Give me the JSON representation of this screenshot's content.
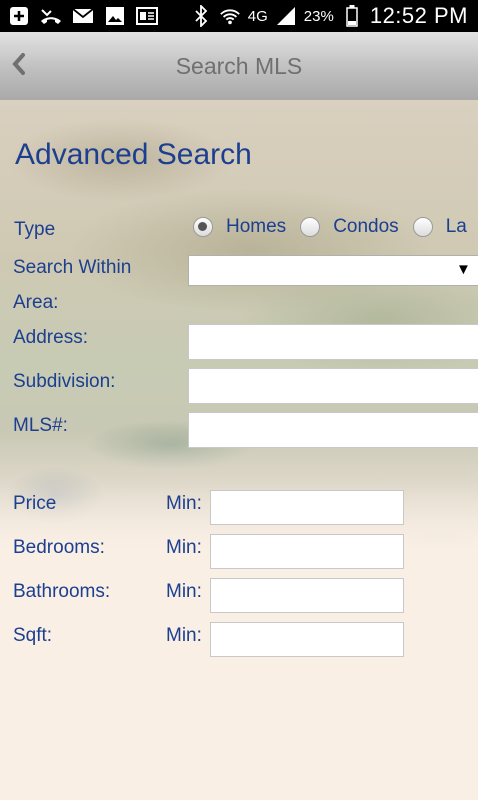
{
  "status_bar": {
    "icons": [
      "plus-icon",
      "missed-call-icon",
      "mail-icon",
      "image-icon",
      "news-icon",
      "bluetooth-icon",
      "wifi-icon",
      "signal-icon",
      "battery-icon"
    ],
    "network": "4G",
    "battery": "23%",
    "time": "12:52 PM"
  },
  "header": {
    "title": "Search MLS",
    "back_icon": "chevron-left-icon"
  },
  "page": {
    "title": "Advanced Search"
  },
  "form": {
    "type_label": "Type",
    "type_options": [
      {
        "label": "Homes",
        "selected": true
      },
      {
        "label": "Condos",
        "selected": false
      },
      {
        "label": "La",
        "selected": false
      }
    ],
    "search_within_label": "Search Within",
    "area_label": "Area:",
    "area_value": "",
    "address_label": "Address:",
    "address_value": "",
    "subdivision_label": "Subdivision:",
    "subdivision_value": "",
    "mls_label": "MLS#:",
    "mls_value": "",
    "price_label": "Price",
    "bedrooms_label": "Bedrooms:",
    "bathrooms_label": "Bathrooms:",
    "sqft_label": "Sqft:",
    "min_label": "Min:"
  },
  "colors": {
    "label_text": "#1c3f8f",
    "page_background": "#f9efe5",
    "header_gradient_top": "#e2e2e2",
    "header_gradient_bottom": "#a9a9a9"
  }
}
